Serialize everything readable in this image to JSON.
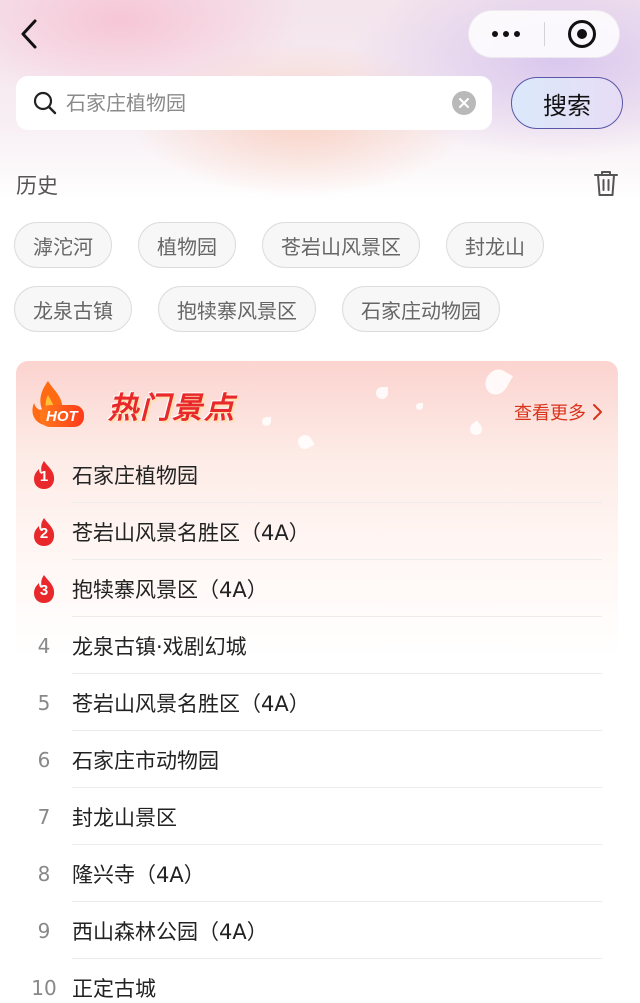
{
  "search": {
    "placeholder": "石家庄植物园",
    "button_label": "搜索"
  },
  "history": {
    "title": "历史",
    "rows": [
      [
        "滹沱河",
        "植物园",
        "苍岩山风景区",
        "封龙山"
      ],
      [
        "龙泉古镇",
        "抱犊寨风景区",
        "石家庄动物园"
      ]
    ]
  },
  "hot": {
    "badge": "HOT",
    "title": "热门景点",
    "more": "查看更多",
    "items": [
      {
        "rank": "1",
        "name": "石家庄植物园"
      },
      {
        "rank": "2",
        "name": "苍岩山风景名胜区（4A）"
      },
      {
        "rank": "3",
        "name": "抱犊寨风景区（4A）"
      },
      {
        "rank": "4",
        "name": "龙泉古镇·戏剧幻城"
      },
      {
        "rank": "5",
        "name": "苍岩山风景名胜区（4A）"
      },
      {
        "rank": "6",
        "name": "石家庄市动物园"
      },
      {
        "rank": "7",
        "name": "封龙山景区"
      },
      {
        "rank": "8",
        "name": "隆兴寺（4A）"
      },
      {
        "rank": "9",
        "name": "西山森林公园（4A）"
      },
      {
        "rank": "10",
        "name": "正定古城"
      }
    ]
  },
  "colors": {
    "accent_red": "#e8282b",
    "search_button_border": "#5a57a8",
    "chip_text": "#666666"
  },
  "icons": {
    "back": "chevron-left-icon",
    "menu": "more-dots-icon",
    "close": "target-circle-icon",
    "search": "search-icon",
    "clear": "clear-circle-icon",
    "delete": "trash-icon",
    "fire": "fire-icon"
  }
}
